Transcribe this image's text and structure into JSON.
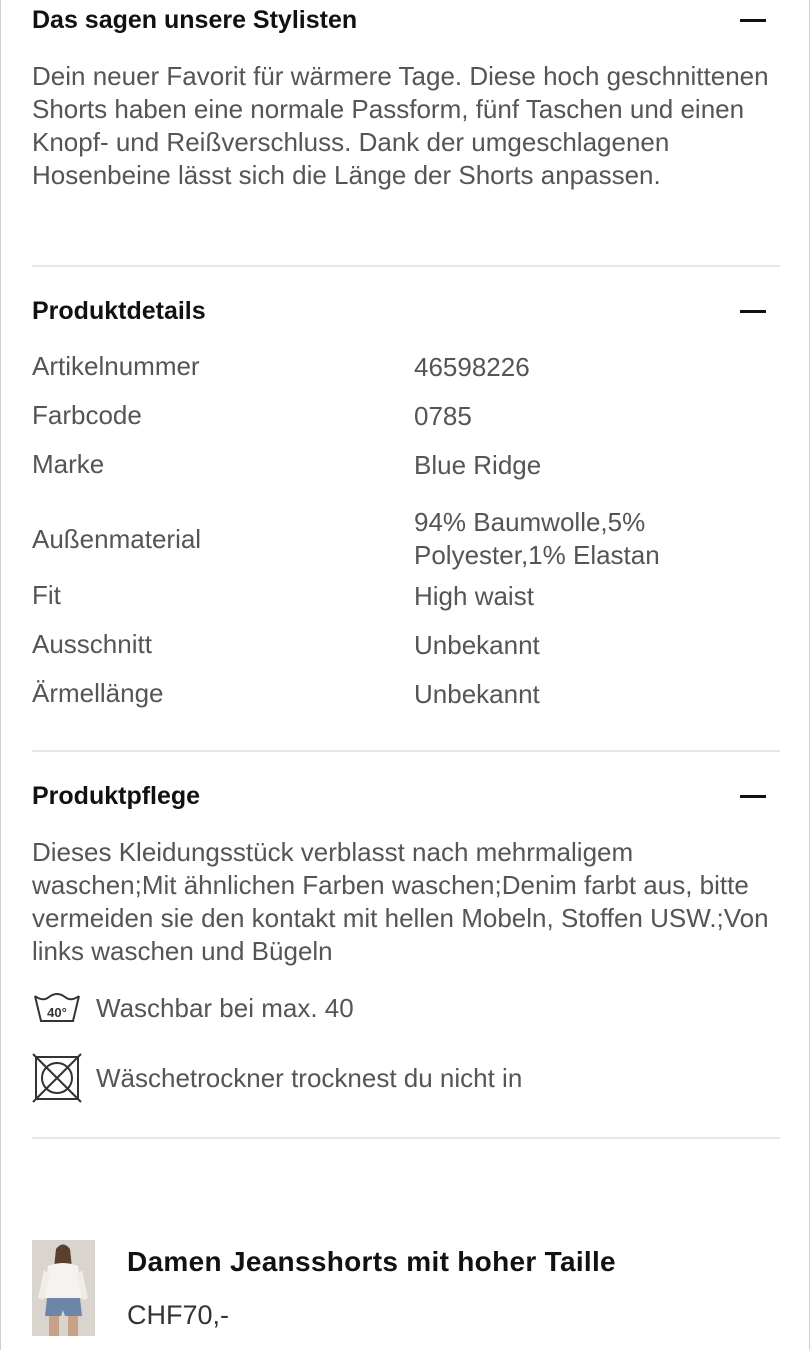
{
  "stylists": {
    "title": "Das sagen unsere Stylisten",
    "text": "Dein neuer Favorit für wärmere Tage. Diese hoch geschnittenen Shorts haben eine normale Passform, fünf Taschen und einen Knopf- und Reißverschluss. Dank der umgeschlagenen Hosenbeine lässt sich die Länge der Shorts anpassen."
  },
  "details": {
    "title": "Produktdetails",
    "rows": [
      {
        "label": "Artikelnummer",
        "value": "46598226"
      },
      {
        "label": "Farbcode",
        "value": "0785"
      },
      {
        "label": "Marke",
        "value": "Blue Ridge"
      },
      {
        "label": "Außenmaterial",
        "value": "94% Baumwolle,5% Polyester,1% Elastan"
      },
      {
        "label": "Fit",
        "value": "High waist"
      },
      {
        "label": "Ausschnitt",
        "value": "Unbekannt"
      },
      {
        "label": "Ärmellänge",
        "value": "Unbekannt"
      }
    ]
  },
  "care": {
    "title": "Produktpflege",
    "text": "Dieses Kleidungsstück verblasst nach mehrmaligem waschen;Mit ähnlichen Farben waschen;Denim farbt aus, bitte vermeiden sie den kontakt mit hellen Mobeln, Stoffen USW.;Von links waschen und Bügeln",
    "wash_badge": "40°",
    "items": [
      {
        "icon": "wash-40-icon",
        "label": "Waschbar bei max. 40"
      },
      {
        "icon": "no-tumble-dry-icon",
        "label": "Wäschetrockner trocknest du nicht in"
      }
    ]
  },
  "product": {
    "title": "Damen Jeansshorts mit hoher Taille",
    "price": "CHF70,-"
  }
}
